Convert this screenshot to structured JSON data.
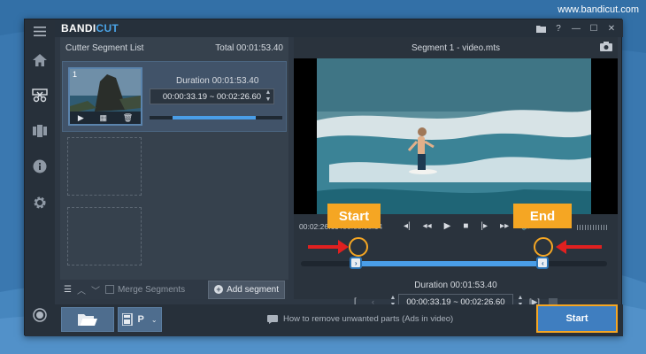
{
  "website": "www.bandicut.com",
  "app": {
    "logo_main": "BANDI",
    "logo_accent": "CUT",
    "window_controls": [
      "folder-icon",
      "help-icon",
      "minimize-icon",
      "maximize-icon",
      "close-icon"
    ]
  },
  "sidebar": {
    "items": [
      {
        "name": "menu-icon"
      },
      {
        "name": "home-icon"
      },
      {
        "name": "cutter-icon"
      },
      {
        "name": "merge-icon"
      },
      {
        "name": "info-icon"
      },
      {
        "name": "settings-icon"
      },
      {
        "name": "record-icon"
      }
    ]
  },
  "segment_list": {
    "title": "Cutter Segment List",
    "total_label": "Total 00:01:53.40",
    "segment": {
      "number": "1",
      "duration_label": "Duration 00:01:53.40",
      "time_range": "00:00:33.19 ~ 00:02:26.60",
      "progress_start": 0.17,
      "progress_end": 0.8
    },
    "footer": {
      "merge_label": "Merge Segments",
      "add_label": "Add segment"
    }
  },
  "player": {
    "title": "Segment 1 - video.mts",
    "current_time": "00:02:26.60",
    "total_time": "00:03:05.14",
    "duration_label": "Duration 00:01:53.40",
    "time_range": "00:00:33.19 ~ 00:02:26.60",
    "start_fraction": 0.18,
    "end_fraction": 0.79
  },
  "annotations": {
    "start_label": "Start",
    "end_label": "End"
  },
  "bottom": {
    "tip": "How to remove unwanted parts (Ads in video)",
    "start_button": "Start",
    "mode_label": "P"
  },
  "colors": {
    "accent": "#4a9ee8",
    "highlight": "#f5a623",
    "arrow": "#e02020"
  }
}
